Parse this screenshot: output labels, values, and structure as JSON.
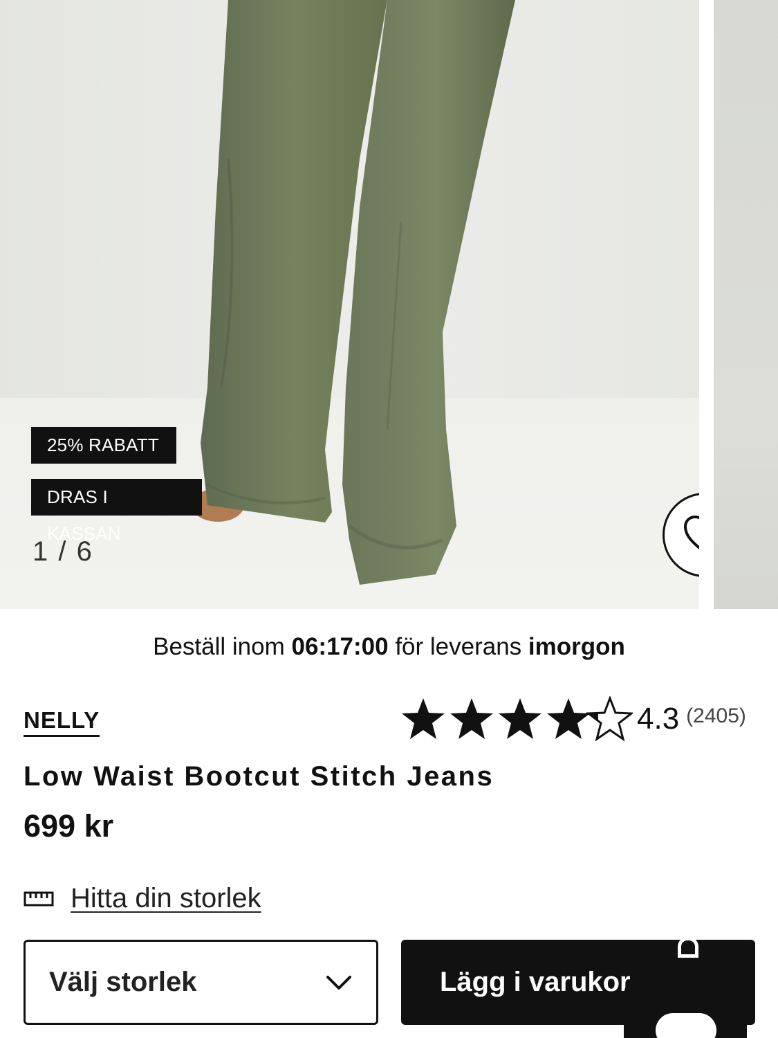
{
  "gallery": {
    "badges": [
      "25% RABATT",
      "DRAS I KASSAN"
    ],
    "counter": "1 / 6",
    "favorite_icon": "heart-icon"
  },
  "delivery": {
    "prefix": "Beställ inom ",
    "time": "06:17:00",
    "middle": " för leverans ",
    "day": "imorgon"
  },
  "product": {
    "brand": "NELLY",
    "title": "Low Waist Bootcut Stitch Jeans",
    "price": "699 kr",
    "rating": {
      "value": "4.3",
      "count": "(2405)",
      "stars": 4.3,
      "max_stars": 5
    }
  },
  "size_guide": {
    "label": "Hitta din storlek",
    "icon": "ruler-icon"
  },
  "size_select": {
    "label": "Välj storlek",
    "icon": "chevron-down-icon"
  },
  "add_to_cart": {
    "label": "Lägg i varukorg",
    "icon": "bag-icon"
  },
  "chat": {
    "icon": "chat-icon"
  },
  "colors": {
    "badge_bg": "#111111",
    "button_bg": "#111111",
    "pants": "#6e7a5e",
    "backdrop": "#e9eae6"
  }
}
